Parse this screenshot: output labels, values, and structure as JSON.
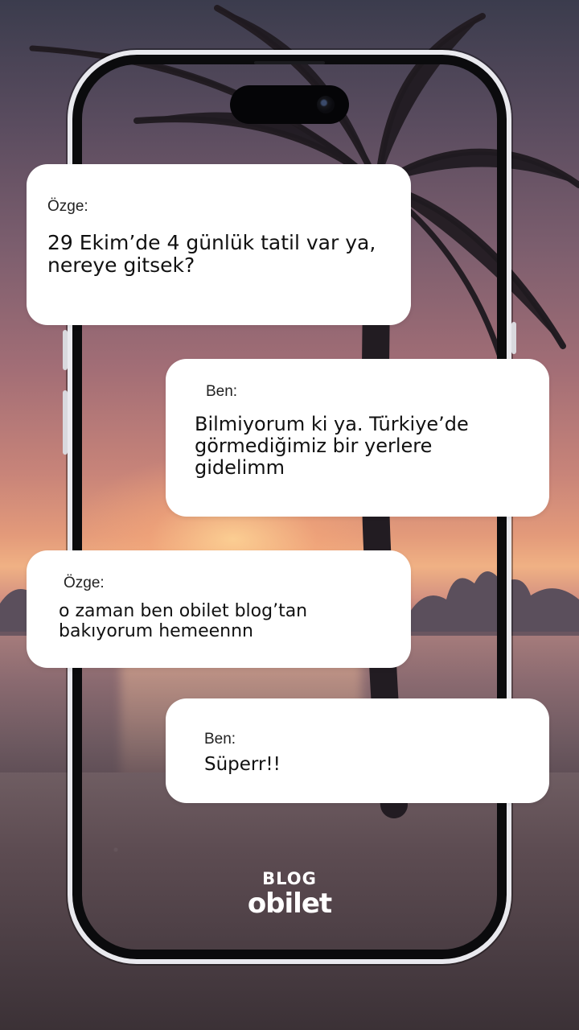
{
  "conversation": {
    "messages": [
      {
        "sender": "Özge:",
        "text": "29 Ekim’de 4 günlük tatil var ya,\nnereye gitsek?"
      },
      {
        "sender": "Ben:",
        "text": "Bilmiyorum ki ya. Türkiye’de\ngörmediğimiz bir yerlere\ngidelimm"
      },
      {
        "sender": "Özge:",
        "text": "o zaman ben obilet blog’tan\nbakıyorum hemeennn"
      },
      {
        "sender": "Ben:",
        "text": "Süperr!!"
      }
    ]
  },
  "logo": {
    "top": "BLOG",
    "bottom": "obilet",
    "color": "#ffffff"
  },
  "colors": {
    "bubble": "#ffffff",
    "text": "#111111",
    "phone_frame": "#e9e9ee"
  },
  "icons": [
    "camera-icon",
    "palm-tree-icon"
  ]
}
